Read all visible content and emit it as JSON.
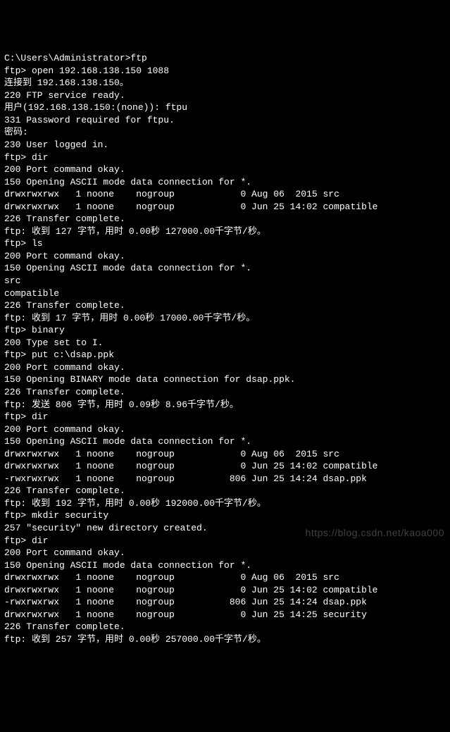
{
  "terminal": {
    "lines": [
      "C:\\Users\\Administrator>ftp",
      "ftp> open 192.168.138.150 1088",
      "连接到 192.168.138.150。",
      "220 FTP service ready.",
      "用户(192.168.138.150:(none)): ftpu",
      "331 Password required for ftpu.",
      "密码:",
      "230 User logged in.",
      "ftp> dir",
      "200 Port command okay.",
      "150 Opening ASCII mode data connection for *.",
      "drwxrwxrwx   1 noone    nogroup            0 Aug 06  2015 src",
      "drwxrwxrwx   1 noone    nogroup            0 Jun 25 14:02 compatible",
      "226 Transfer complete.",
      "ftp: 收到 127 字节，用时 0.00秒 127000.00千字节/秒。",
      "ftp> ls",
      "200 Port command okay.",
      "150 Opening ASCII mode data connection for *.",
      "src",
      "compatible",
      "226 Transfer complete.",
      "ftp: 收到 17 字节，用时 0.00秒 17000.00千字节/秒。",
      "ftp> binary",
      "200 Type set to I.",
      "ftp> put c:\\dsap.ppk",
      "200 Port command okay.",
      "150 Opening BINARY mode data connection for dsap.ppk.",
      "226 Transfer complete.",
      "ftp: 发送 806 字节，用时 0.09秒 8.96千字节/秒。",
      "ftp> dir",
      "200 Port command okay.",
      "150 Opening ASCII mode data connection for *.",
      "drwxrwxrwx   1 noone    nogroup            0 Aug 06  2015 src",
      "drwxrwxrwx   1 noone    nogroup            0 Jun 25 14:02 compatible",
      "-rwxrwxrwx   1 noone    nogroup          806 Jun 25 14:24 dsap.ppk",
      "226 Transfer complete.",
      "ftp: 收到 192 字节，用时 0.00秒 192000.00千字节/秒。",
      "ftp> mkdir security",
      "257 \"security\" new directory created.",
      "ftp> dir",
      "200 Port command okay.",
      "150 Opening ASCII mode data connection for *.",
      "drwxrwxrwx   1 noone    nogroup            0 Aug 06  2015 src",
      "drwxrwxrwx   1 noone    nogroup            0 Jun 25 14:02 compatible",
      "-rwxrwxrwx   1 noone    nogroup          806 Jun 25 14:24 dsap.ppk",
      "drwxrwxrwx   1 noone    nogroup            0 Jun 25 14:25 security",
      "226 Transfer complete.",
      "ftp: 收到 257 字节，用时 0.00秒 257000.00千字节/秒。"
    ]
  },
  "watermark": "https://blog.csdn.net/kaoa000"
}
